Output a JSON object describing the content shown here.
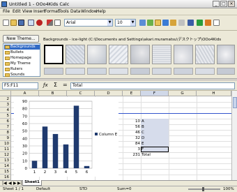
{
  "window": {
    "title": "Untitled 1 - OOo4Kids Calc",
    "min": "_",
    "max": "□",
    "close": "×"
  },
  "menu": [
    "File",
    "Edit",
    "View",
    "Insert",
    "Format",
    "Tools",
    "Data",
    "Window",
    "Help"
  ],
  "toolbar": {
    "font_name": "Arial",
    "font_size": "10"
  },
  "gallery": {
    "new_theme_label": "New Theme...",
    "themes": [
      "Backgrounds",
      "Bullets",
      "Homepage",
      "My Theme",
      "Rulers",
      "Sounds"
    ],
    "selected_theme": "Backgrounds",
    "header": "Backgrounds - ice-light (C:\\Documents and Settings\\akari.muramatsu\\デスクトップ\\OOo4Kids"
  },
  "formula": {
    "cell_ref": "F5:F11",
    "content": "Total",
    "fx_icon": "ƒx",
    "sum_icon": "Σ",
    "eq_icon": "="
  },
  "columns": [
    "A",
    "B",
    "C",
    "D",
    "E",
    "F",
    "G",
    "H"
  ],
  "rows": [
    "2",
    "3",
    "4",
    "5",
    "6",
    "7",
    "8",
    "9",
    "10",
    "11",
    "12",
    "13",
    "14",
    "15",
    "16"
  ],
  "cells": {
    "e6": "10",
    "f6": "A",
    "e7": "56",
    "f7": "B",
    "e8": "46",
    "f8": "C",
    "e9": "32",
    "f9": "D",
    "e10": "84",
    "f10": "E",
    "e11": "3",
    "f11": "F",
    "e12": "231",
    "f12": "Total"
  },
  "chart_data": {
    "type": "bar",
    "categories": [
      "1",
      "2",
      "3",
      "4",
      "5",
      "6"
    ],
    "series": [
      {
        "name": "Column E",
        "values": [
          10,
          56,
          46,
          32,
          84,
          3
        ]
      }
    ],
    "yticks": [
      "0",
      "10",
      "20",
      "30",
      "40",
      "50",
      "60",
      "70",
      "80",
      "90"
    ],
    "ylim": [
      0,
      90
    ],
    "legend": "right",
    "bar_color": "#1f3a6e"
  },
  "sheet_tab": "Sheet1",
  "status": {
    "sheet": "Sheet 1 / 1",
    "style": "Default",
    "mode": "STD",
    "sum": "Sum=0",
    "zoom": "100%"
  }
}
